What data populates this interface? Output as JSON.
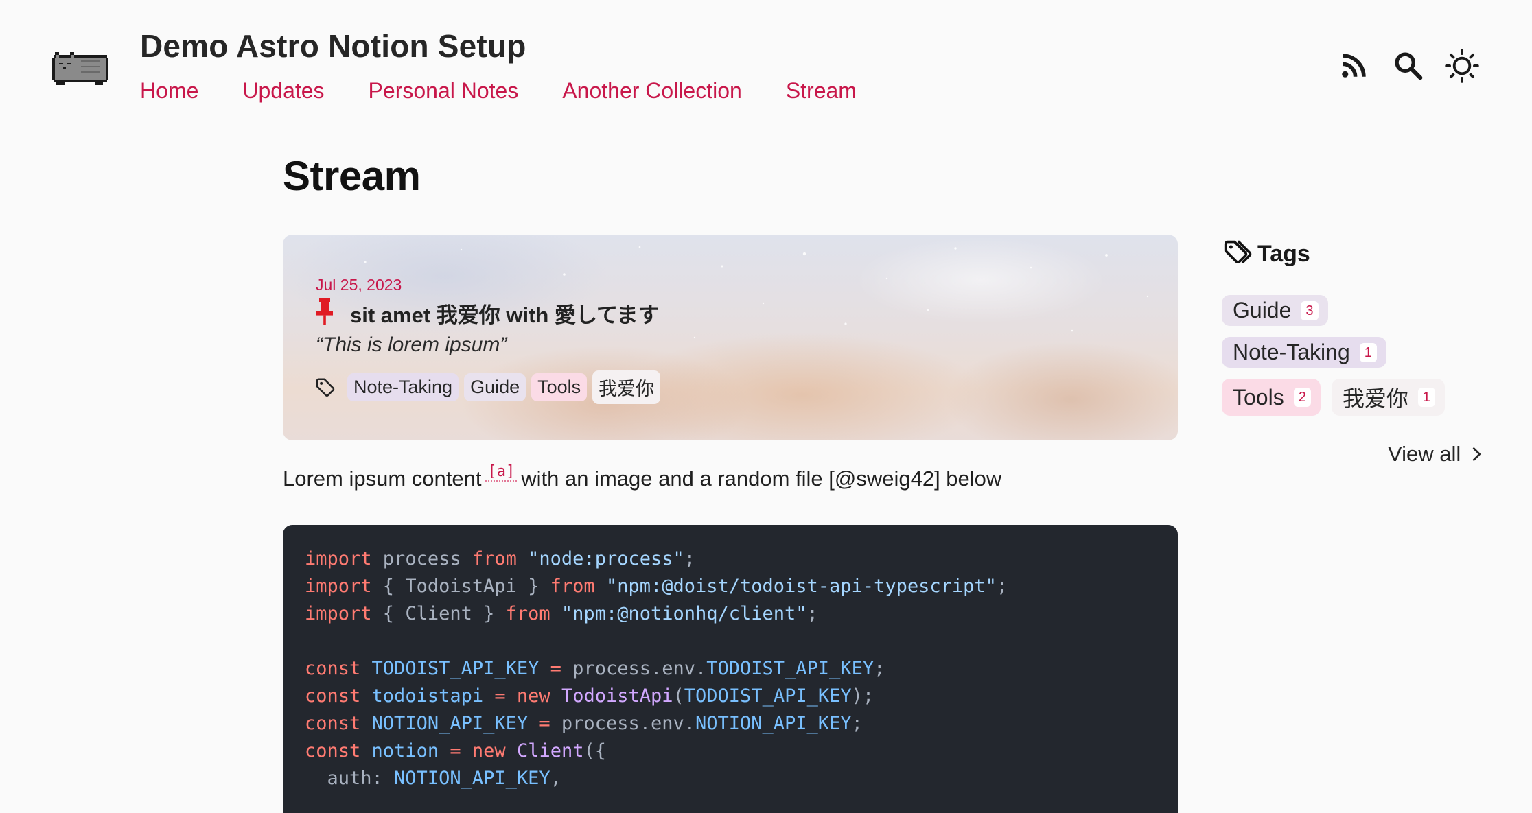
{
  "header": {
    "site_title": "Demo Astro Notion Setup",
    "nav": [
      "Home",
      "Updates",
      "Personal Notes",
      "Another Collection",
      "Stream"
    ],
    "icons": [
      "rss-icon",
      "search-icon",
      "sun-icon"
    ]
  },
  "main": {
    "heading": "Stream",
    "post": {
      "date": "Jul 25, 2023",
      "title": "sit amet 我爱你 with 愛してます",
      "quote": "“This is lorem ipsum”",
      "pinned": true,
      "tags": [
        {
          "label": "Note-Taking",
          "color": "#e6ddee"
        },
        {
          "label": "Guide",
          "color": "#e9e2ee"
        },
        {
          "label": "Tools",
          "color": "#fbdbe6"
        },
        {
          "label": "我爱你",
          "color": "#f5f1f2"
        }
      ]
    },
    "body_text": {
      "before": "Lorem ipsum content",
      "footnote": "[a]",
      "after": "with an image and a random file [@sweig42] below"
    },
    "code_lines": [
      [
        [
          "kw",
          "import"
        ],
        [
          "plain",
          " process "
        ],
        [
          "kw",
          "from"
        ],
        [
          "plain",
          " "
        ],
        [
          "str",
          "\"node:process\""
        ],
        [
          "plain",
          ";"
        ]
      ],
      [
        [
          "kw",
          "import"
        ],
        [
          "plain",
          " { TodoistApi } "
        ],
        [
          "kw",
          "from"
        ],
        [
          "plain",
          " "
        ],
        [
          "str",
          "\"npm:@doist/todoist-api-typescript\""
        ],
        [
          "plain",
          ";"
        ]
      ],
      [
        [
          "kw",
          "import"
        ],
        [
          "plain",
          " { Client } "
        ],
        [
          "kw",
          "from"
        ],
        [
          "plain",
          " "
        ],
        [
          "str",
          "\"npm:@notionhq/client\""
        ],
        [
          "plain",
          ";"
        ]
      ],
      [],
      [
        [
          "kw",
          "const"
        ],
        [
          "plain",
          " "
        ],
        [
          "const",
          "TODOIST_API_KEY"
        ],
        [
          "plain",
          " "
        ],
        [
          "kw",
          "="
        ],
        [
          "plain",
          " process.env."
        ],
        [
          "const",
          "TODOIST_API_KEY"
        ],
        [
          "plain",
          ";"
        ]
      ],
      [
        [
          "kw",
          "const"
        ],
        [
          "plain",
          " "
        ],
        [
          "const",
          "todoistapi"
        ],
        [
          "plain",
          " "
        ],
        [
          "kw",
          "="
        ],
        [
          "plain",
          " "
        ],
        [
          "kw",
          "new"
        ],
        [
          "plain",
          " "
        ],
        [
          "fn",
          "TodoistApi"
        ],
        [
          "plain",
          "("
        ],
        [
          "const",
          "TODOIST_API_KEY"
        ],
        [
          "plain",
          ");"
        ]
      ],
      [
        [
          "kw",
          "const"
        ],
        [
          "plain",
          " "
        ],
        [
          "const",
          "NOTION_API_KEY"
        ],
        [
          "plain",
          " "
        ],
        [
          "kw",
          "="
        ],
        [
          "plain",
          " process.env."
        ],
        [
          "const",
          "NOTION_API_KEY"
        ],
        [
          "plain",
          ";"
        ]
      ],
      [
        [
          "kw",
          "const"
        ],
        [
          "plain",
          " "
        ],
        [
          "const",
          "notion"
        ],
        [
          "plain",
          " "
        ],
        [
          "kw",
          "="
        ],
        [
          "plain",
          " "
        ],
        [
          "kw",
          "new"
        ],
        [
          "plain",
          " "
        ],
        [
          "fn",
          "Client"
        ],
        [
          "plain",
          "({"
        ]
      ],
      [
        [
          "plain",
          "  auth: "
        ],
        [
          "const",
          "NOTION_API_KEY"
        ],
        [
          "plain",
          ","
        ]
      ]
    ]
  },
  "sidebar": {
    "heading": "Tags",
    "tags": [
      [
        {
          "label": "Guide",
          "count": "3",
          "color": "#e9e2ee"
        }
      ],
      [
        {
          "label": "Note-Taking",
          "count": "1",
          "color": "#e6ddee"
        }
      ],
      [
        {
          "label": "Tools",
          "count": "2",
          "color": "#fbdbe6"
        },
        {
          "label": "我爱你",
          "count": "1",
          "color": "#f5f1f2"
        }
      ]
    ],
    "view_all": "View all"
  },
  "colors": {
    "accent": "#c8174a",
    "code_bg": "#23272e",
    "pin": "#e01b24"
  }
}
